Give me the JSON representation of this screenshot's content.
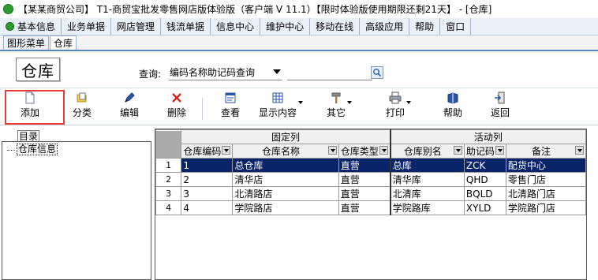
{
  "window": {
    "title": "【某某商贸公司】 T1-商贸宝批发零售网店版体验版（客户端 V 11.1）【限时体验版使用期限还剩21天】 - [仓库]"
  },
  "menu": [
    {
      "label": "基本信息"
    },
    {
      "label": "业务单据"
    },
    {
      "label": "网店管理"
    },
    {
      "label": "钱流单据"
    },
    {
      "label": "信息中心"
    },
    {
      "label": "维护中心"
    },
    {
      "label": "移动在线"
    },
    {
      "label": "高级应用"
    },
    {
      "label": "帮助"
    },
    {
      "label": "窗口"
    }
  ],
  "tabs": [
    {
      "label": "图形菜单",
      "active": false
    },
    {
      "label": "仓库",
      "active": true
    }
  ],
  "page": {
    "big_title": "仓库"
  },
  "query": {
    "label": "查询:",
    "mode": "编码名称助记码查询",
    "value": ""
  },
  "toolbar": {
    "add": "添加",
    "category": "分类",
    "edit": "编辑",
    "delete": "删除",
    "view": "查看",
    "display": "显示内容",
    "other": "其它",
    "print": "打印",
    "help": "帮助",
    "back": "返回"
  },
  "tree": {
    "tab": "目录",
    "root": "仓库信息"
  },
  "grid": {
    "groups": {
      "fixed": "固定列",
      "active": "活动列"
    },
    "columns": [
      "仓库编码",
      "仓库名称",
      "仓库类型",
      "仓库别名",
      "助记码",
      "备注"
    ],
    "rows": [
      {
        "n": "1",
        "code": "1",
        "name": "总仓库",
        "type": "直营",
        "alias": "总库",
        "mnemonic": "ZCK",
        "note": "配货中心"
      },
      {
        "n": "2",
        "code": "2",
        "name": "清华店",
        "type": "直营",
        "alias": "清华库",
        "mnemonic": "QHD",
        "note": "零售门店"
      },
      {
        "n": "3",
        "code": "3",
        "name": "北清路店",
        "type": "直营",
        "alias": "北清库",
        "mnemonic": "BQLD",
        "note": "北清路门店"
      },
      {
        "n": "4",
        "code": "4",
        "name": "学院路店",
        "type": "直营",
        "alias": "学院路库",
        "mnemonic": "XYLD",
        "note": "学院路门店"
      }
    ],
    "selected_row": 1
  },
  "colors": {
    "selection": "#0a246a",
    "highlight_frame": "#e83c3c",
    "menu_bg": "#eaf0f8"
  }
}
